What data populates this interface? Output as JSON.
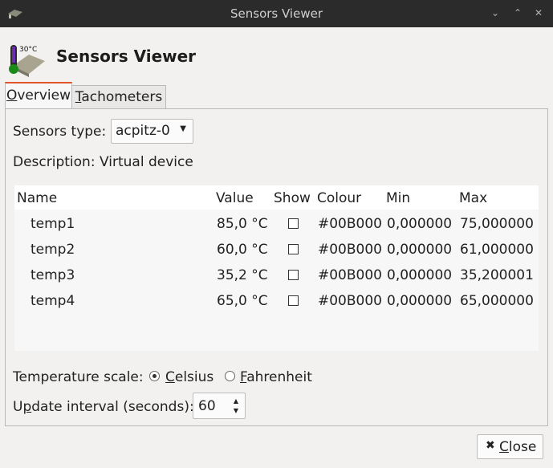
{
  "window": {
    "title": "Sensors Viewer",
    "controls": [
      "minimize",
      "maximize",
      "close"
    ]
  },
  "header": {
    "title": "Sensors Viewer",
    "logo_text": "30°C"
  },
  "tabs": [
    {
      "label": "Overview",
      "mnemonic": "O",
      "rest": "verview",
      "active": true
    },
    {
      "label": "Tachometers",
      "mnemonic": "T",
      "rest": "achometers",
      "active": false
    }
  ],
  "overview": {
    "sensors_type_label_pre": "Sensors type: ",
    "sensors_type_mnemonic": "",
    "sensors_type_label": "Sensors type:",
    "sensors_type_value": "acpitz-0",
    "description_label": "Description:",
    "description_value": "Virtual device",
    "columns": [
      "Name",
      "Value",
      "Show",
      "Colour",
      "Min",
      "Max"
    ],
    "rows": [
      {
        "name": "temp1",
        "value": "85,0 °C",
        "show": false,
        "colour": "#00B000",
        "min": "0,000000",
        "max": "75,000000"
      },
      {
        "name": "temp2",
        "value": "60,0 °C",
        "show": false,
        "colour": "#00B000",
        "min": "0,000000",
        "max": "61,000000"
      },
      {
        "name": "temp3",
        "value": "35,2 °C",
        "show": false,
        "colour": "#00B000",
        "min": "0,000000",
        "max": "35,200001"
      },
      {
        "name": "temp4",
        "value": "65,0 °C",
        "show": false,
        "colour": "#00B000",
        "min": "0,000000",
        "max": "65,000000"
      }
    ],
    "temperature_scale_label": "Temperature scale:",
    "scale_options": [
      {
        "label": "Celsius",
        "mnemonic": "C",
        "rest": "elsius",
        "selected": true
      },
      {
        "label": "Fahrenheit",
        "mnemonic": "F",
        "rest": "ahrenheit",
        "selected": false
      }
    ],
    "update_interval_label": "Update interval (seconds):",
    "update_interval_mnemonic": "p",
    "update_interval_pre": "U",
    "update_interval_rest": "date interval (seconds):",
    "update_interval_value": "60"
  },
  "footer": {
    "close_label": "Close",
    "close_mnemonic": "C",
    "close_rest": "lose"
  },
  "colors": {
    "titlebar": "#2b2b2b",
    "tab_accent": "#e0562a",
    "background": "#f2f1f0"
  }
}
